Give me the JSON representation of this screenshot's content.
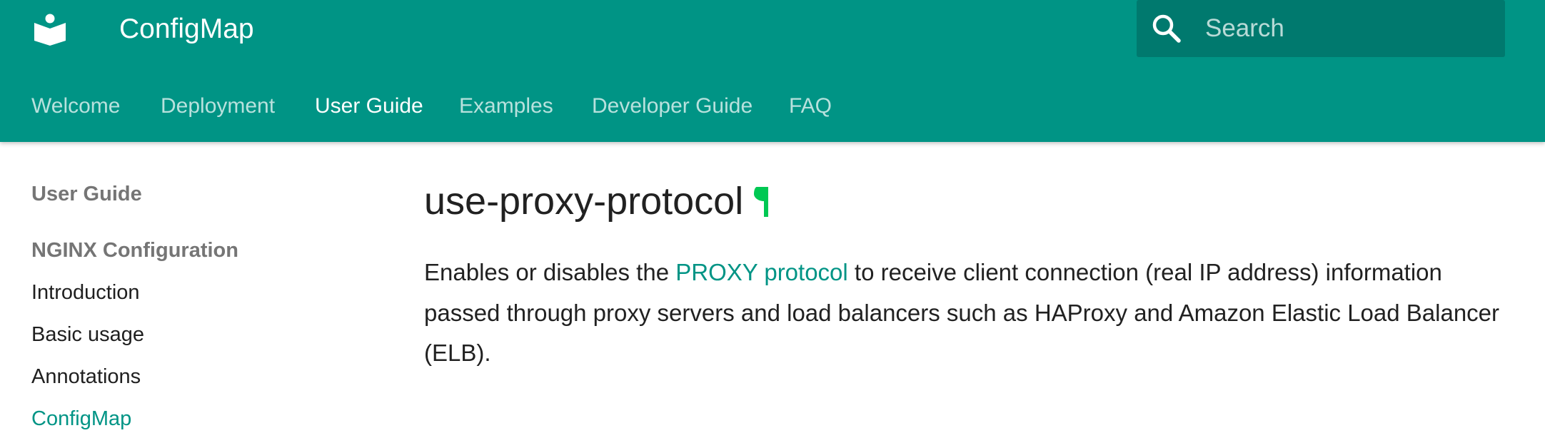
{
  "header": {
    "site_title": "ConfigMap",
    "search": {
      "placeholder": "Search"
    },
    "tabs": [
      {
        "label": "Welcome",
        "active": false
      },
      {
        "label": "Deployment",
        "active": false
      },
      {
        "label": "User Guide",
        "active": true
      },
      {
        "label": "Examples",
        "active": false
      },
      {
        "label": "Developer Guide",
        "active": false
      },
      {
        "label": "FAQ",
        "active": false
      }
    ]
  },
  "sidebar": {
    "section_title": "User Guide",
    "group_title": "NGINX Configuration",
    "items": [
      {
        "label": "Introduction",
        "current": false
      },
      {
        "label": "Basic usage",
        "current": false
      },
      {
        "label": "Annotations",
        "current": false
      },
      {
        "label": "ConfigMap",
        "current": true
      }
    ]
  },
  "content": {
    "title": "use-proxy-protocol",
    "text_before_link": "Enables or disables the ",
    "link_text": "PROXY protocol",
    "text_after_link": " to receive client connection (real IP address) information passed through proxy servers and load balancers such as HAProxy and Amazon Elastic Load Balancer (ELB)."
  },
  "colors": {
    "header_bg": "#009485",
    "search_bg": "#00796e",
    "accent": "#009485",
    "permalink": "#00c853"
  },
  "icons": {
    "logo": "book-reader-icon",
    "search": "search-icon",
    "permalink": "pilcrow-icon"
  }
}
